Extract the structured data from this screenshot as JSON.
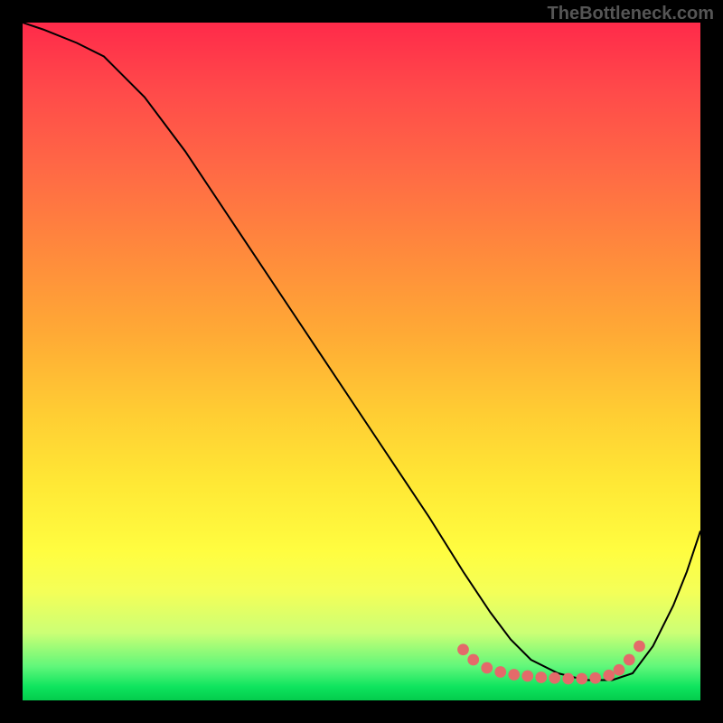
{
  "watermark": "TheBottleneck.com",
  "chart_data": {
    "type": "line",
    "title": "",
    "xlabel": "",
    "ylabel": "",
    "xlim": [
      0,
      100
    ],
    "ylim": [
      0,
      100
    ],
    "series": [
      {
        "name": "curve",
        "x": [
          0,
          3,
          8,
          12,
          18,
          24,
          30,
          36,
          42,
          48,
          54,
          60,
          65,
          69,
          72,
          75,
          79,
          83,
          87,
          90,
          93,
          96,
          98,
          100
        ],
        "y": [
          100,
          99,
          97,
          95,
          89,
          81,
          72,
          63,
          54,
          45,
          36,
          27,
          19,
          13,
          9,
          6,
          4,
          3,
          3,
          4,
          8,
          14,
          19,
          25
        ]
      }
    ],
    "highlight_band": {
      "name": "valley-dots",
      "points": [
        {
          "x": 65,
          "y": 7.5
        },
        {
          "x": 66.5,
          "y": 6
        },
        {
          "x": 68.5,
          "y": 4.8
        },
        {
          "x": 70.5,
          "y": 4.2
        },
        {
          "x": 72.5,
          "y": 3.8
        },
        {
          "x": 74.5,
          "y": 3.6
        },
        {
          "x": 76.5,
          "y": 3.4
        },
        {
          "x": 78.5,
          "y": 3.3
        },
        {
          "x": 80.5,
          "y": 3.2
        },
        {
          "x": 82.5,
          "y": 3.2
        },
        {
          "x": 84.5,
          "y": 3.3
        },
        {
          "x": 86.5,
          "y": 3.7
        },
        {
          "x": 88,
          "y": 4.5
        },
        {
          "x": 89.5,
          "y": 6
        },
        {
          "x": 91,
          "y": 8
        }
      ]
    },
    "colors": {
      "curve": "#000000",
      "dots": "#e46a6a",
      "gradient_top": "#ff2a4a",
      "gradient_bottom": "#03cc4c"
    }
  }
}
